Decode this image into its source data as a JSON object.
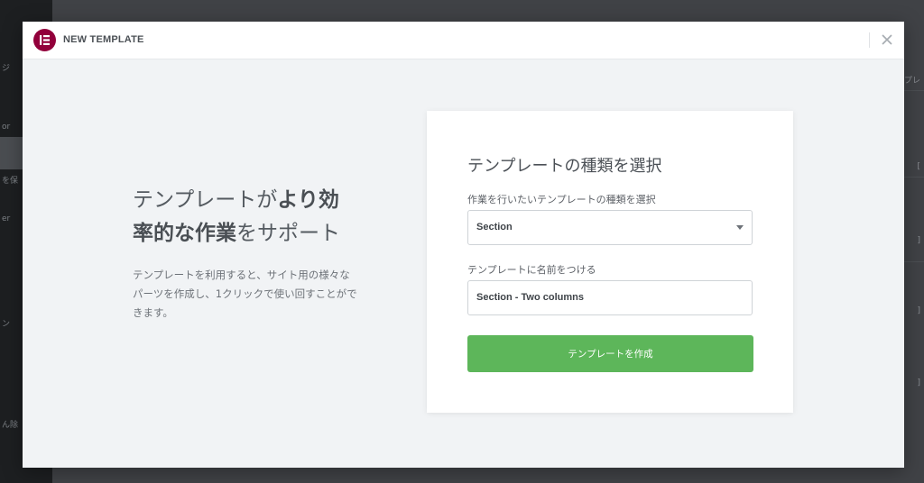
{
  "modal": {
    "title": "NEW TEMPLATE"
  },
  "promo": {
    "title_part1": "テンプレートが",
    "title_bold1": "より効率的な作業",
    "title_part2": "をサポート",
    "description": "テンプレートを利用すると、サイト用の様々なパーツを作成し、1クリックで使い回すことができます。"
  },
  "form": {
    "title": "テンプレートの種類を選択",
    "type_label": "作業を行いたいテンプレートの種類を選択",
    "type_value": "Section",
    "name_label": "テンプレートに名前をつける",
    "name_value": "Section - Two columns",
    "submit_label": "テンプレートを作成"
  },
  "backdrop": {
    "left_fragments": [
      "ジ",
      "or",
      "を保",
      "er",
      "ン",
      "ん除"
    ],
    "right_fragments": [
      "プレ",
      "[",
      "]",
      "]",
      "]"
    ]
  },
  "colors": {
    "brand": "#92003b",
    "submit": "#5db65a",
    "modal_bg": "#f1f3f5"
  },
  "icons": {
    "logo": "elementor-logo-icon",
    "close": "close-icon",
    "dropdown": "chevron-down-icon"
  }
}
